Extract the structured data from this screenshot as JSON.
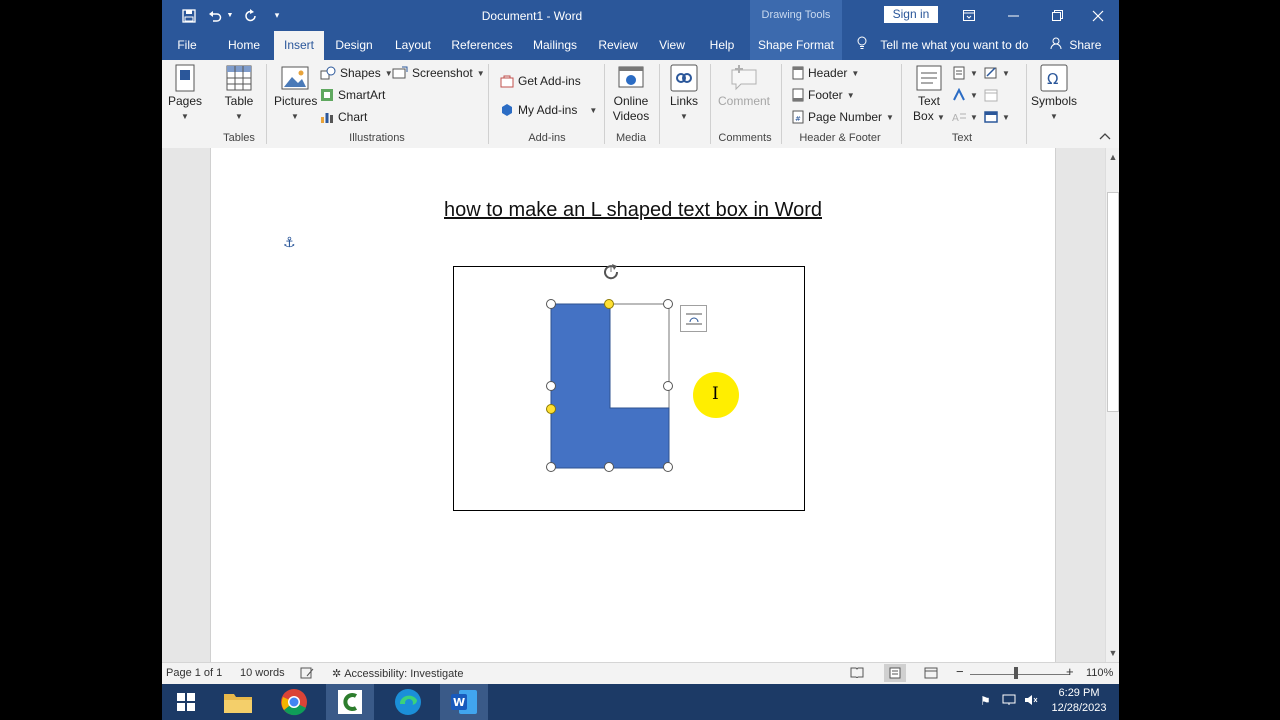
{
  "window": {
    "title": "Document1  -  Word",
    "contextual_tab_header": "Drawing Tools",
    "sign_in": "Sign in"
  },
  "tabs": {
    "file": "File",
    "home": "Home",
    "insert": "Insert",
    "design": "Design",
    "layout": "Layout",
    "references": "References",
    "mailings": "Mailings",
    "review": "Review",
    "view": "View",
    "help": "Help",
    "shape_format": "Shape Format",
    "tell_me": "Tell me what you want to do",
    "share": "Share"
  },
  "ribbon": {
    "pages": "Pages",
    "table": "Table",
    "tables_group": "Tables",
    "pictures": "Pictures",
    "shapes": "Shapes",
    "screenshot": "Screenshot",
    "smartart": "SmartArt",
    "chart": "Chart",
    "illustrations_group": "Illustrations",
    "get_addins": "Get Add-ins",
    "my_addins": "My Add-ins",
    "addins_group": "Add-ins",
    "online": "Online",
    "videos": "Videos",
    "media_group": "Media",
    "links": "Links",
    "comment": "Comment",
    "comments_group": "Comments",
    "header": "Header",
    "footer": "Footer",
    "page_number": "Page Number",
    "header_footer_group": "Header & Footer",
    "text_box_line1": "Text",
    "text_box_line2": "Box",
    "text_group": "Text",
    "symbols": "Symbols"
  },
  "document": {
    "heading": "how to make an L shaped text box in Word",
    "shape_color": "#4472c4"
  },
  "status": {
    "page": "Page 1 of 1",
    "words": "10 words",
    "accessibility": "Accessibility: Investigate",
    "zoom": "110%",
    "zoom_minus": "−",
    "zoom_plus": "+"
  },
  "taskbar": {
    "time": "6:29 PM",
    "date": "12/28/2023"
  },
  "colors": {
    "word_blue": "#2b579a",
    "highlight": "#ffee00"
  }
}
